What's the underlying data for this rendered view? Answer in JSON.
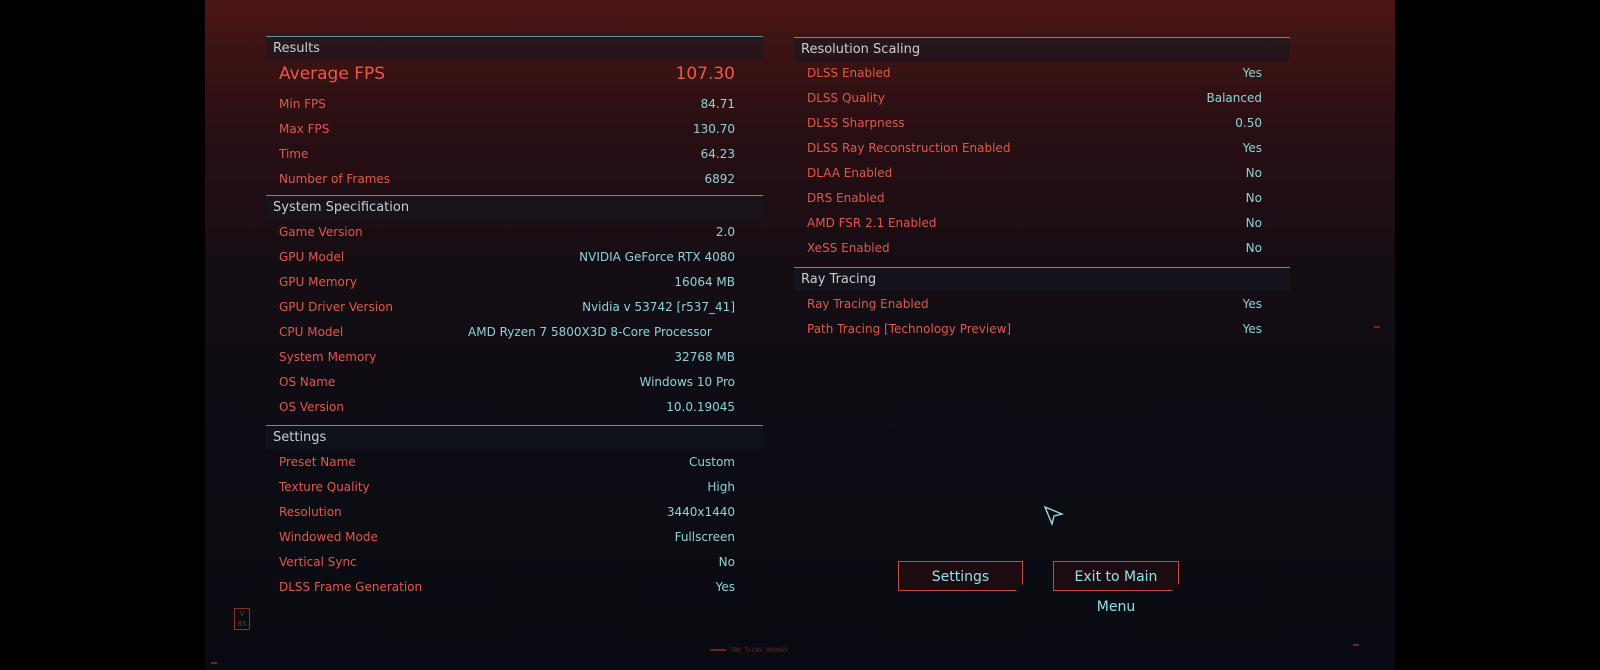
{
  "results": {
    "header": "Results",
    "rows": [
      {
        "label": "Average FPS",
        "value": "107.30"
      },
      {
        "label": "Min FPS",
        "value": "84.71"
      },
      {
        "label": "Max FPS",
        "value": "130.70"
      },
      {
        "label": "Time",
        "value": "64.23"
      },
      {
        "label": "Number of Frames",
        "value": "6892"
      }
    ]
  },
  "system": {
    "header": "System Specification",
    "rows": [
      {
        "label": "Game Version",
        "value": "2.0"
      },
      {
        "label": "GPU Model",
        "value": "NVIDIA GeForce RTX 4080"
      },
      {
        "label": "GPU Memory",
        "value": "16064 MB"
      },
      {
        "label": "GPU Driver Version",
        "value": "Nvidia v 53742 [r537_41]"
      },
      {
        "label": "CPU Model",
        "value": "AMD Ryzen 7 5800X3D 8-Core Processor"
      },
      {
        "label": "System Memory",
        "value": "32768 MB"
      },
      {
        "label": "OS Name",
        "value": "Windows 10 Pro"
      },
      {
        "label": "OS Version",
        "value": "10.0.19045"
      }
    ]
  },
  "settings": {
    "header": "Settings",
    "rows": [
      {
        "label": "Preset Name",
        "value": "Custom"
      },
      {
        "label": "Texture Quality",
        "value": "High"
      },
      {
        "label": "Resolution",
        "value": "3440x1440"
      },
      {
        "label": "Windowed Mode",
        "value": "Fullscreen"
      },
      {
        "label": "Vertical Sync",
        "value": "No"
      },
      {
        "label": "DLSS Frame Generation",
        "value": "Yes"
      }
    ]
  },
  "resolution_scaling": {
    "header": "Resolution Scaling",
    "rows": [
      {
        "label": "DLSS Enabled",
        "value": "Yes"
      },
      {
        "label": "DLSS Quality",
        "value": "Balanced"
      },
      {
        "label": "DLSS Sharpness",
        "value": "0.50"
      },
      {
        "label": "DLSS Ray Reconstruction Enabled",
        "value": "Yes"
      },
      {
        "label": "DLAA Enabled",
        "value": "No"
      },
      {
        "label": "DRS Enabled",
        "value": "No"
      },
      {
        "label": "AMD FSR 2.1 Enabled",
        "value": "No"
      },
      {
        "label": "XeSS Enabled",
        "value": "No"
      }
    ]
  },
  "ray_tracing": {
    "header": "Ray Tracing",
    "rows": [
      {
        "label": "Ray Tracing Enabled",
        "value": "Yes"
      },
      {
        "label": "Path Tracing [Technology Preview]",
        "value": "Yes"
      }
    ]
  },
  "buttons": {
    "settings": "Settings",
    "exit": "Exit to Main Menu"
  },
  "footer": {
    "build_tag": "TRN_TLCAS_000065",
    "logo": "V 85"
  },
  "colors": {
    "label": "#e0594a",
    "value": "#8fd3d9",
    "divider": "#4f9aa4",
    "button_border": "#c94a40"
  }
}
